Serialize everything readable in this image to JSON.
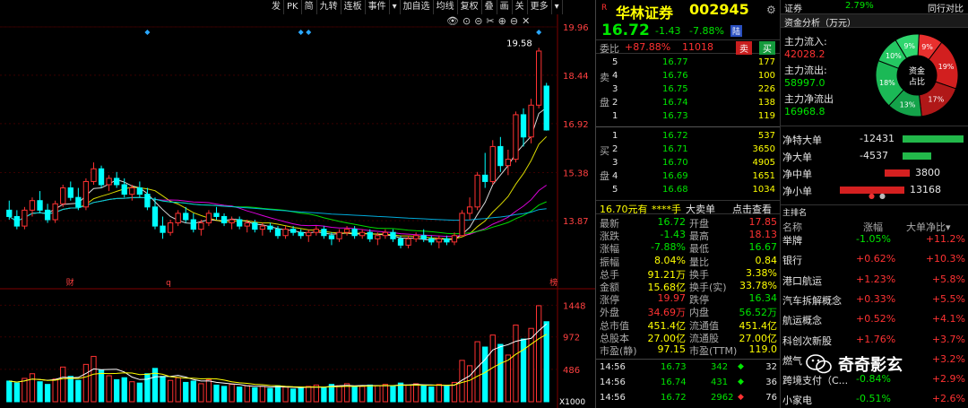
{
  "toolbar": {
    "items": [
      "发",
      "PK",
      "简",
      "九转",
      "连板",
      "事件",
      "▾",
      "加自选",
      "均线",
      "复权",
      "叠",
      "画",
      "关",
      "更多",
      "▾"
    ]
  },
  "iconbar": [
    "👁",
    "⊙",
    "⊝",
    "✂",
    "⊕",
    "⊖",
    "✕"
  ],
  "chart_data": {
    "type": "candlestick",
    "price_axis": {
      "ticks": [
        "19.96",
        "18.44",
        "16.92",
        "15.38",
        "13.87"
      ],
      "ylim": [
        12.35,
        19.96
      ]
    },
    "volume_axis": {
      "ticks": [
        "1448",
        "972",
        "486"
      ],
      "unit": "X1000"
    },
    "high_label": "19.58",
    "markers": [
      "财",
      "q",
      "榜"
    ],
    "candles": [
      {
        "o": 14.2,
        "h": 14.5,
        "l": 13.9,
        "c": 14.0
      },
      {
        "o": 14.0,
        "h": 14.2,
        "l": 13.6,
        "c": 13.7
      },
      {
        "o": 13.7,
        "h": 14.3,
        "l": 13.6,
        "c": 14.2
      },
      {
        "o": 14.2,
        "h": 14.6,
        "l": 14.0,
        "c": 14.5
      },
      {
        "o": 14.5,
        "h": 14.8,
        "l": 14.1,
        "c": 14.2
      },
      {
        "o": 14.2,
        "h": 14.4,
        "l": 13.8,
        "c": 13.9
      },
      {
        "o": 13.9,
        "h": 14.5,
        "l": 13.8,
        "c": 14.4
      },
      {
        "o": 14.4,
        "h": 15.0,
        "l": 14.3,
        "c": 14.9
      },
      {
        "o": 14.9,
        "h": 15.1,
        "l": 14.5,
        "c": 14.6
      },
      {
        "o": 14.6,
        "h": 14.9,
        "l": 14.2,
        "c": 14.3
      },
      {
        "o": 14.3,
        "h": 15.2,
        "l": 14.2,
        "c": 15.1
      },
      {
        "o": 15.1,
        "h": 15.7,
        "l": 15.0,
        "c": 15.5
      },
      {
        "o": 15.5,
        "h": 15.6,
        "l": 14.9,
        "c": 15.0
      },
      {
        "o": 15.0,
        "h": 15.3,
        "l": 14.8,
        "c": 15.2
      },
      {
        "o": 15.2,
        "h": 15.4,
        "l": 14.9,
        "c": 15.0
      },
      {
        "o": 15.0,
        "h": 15.2,
        "l": 14.6,
        "c": 14.7
      },
      {
        "o": 14.7,
        "h": 15.0,
        "l": 14.5,
        "c": 14.9
      },
      {
        "o": 14.9,
        "h": 15.1,
        "l": 14.6,
        "c": 14.7
      },
      {
        "o": 14.7,
        "h": 14.9,
        "l": 14.2,
        "c": 14.3
      },
      {
        "o": 14.3,
        "h": 14.6,
        "l": 13.6,
        "c": 13.7
      },
      {
        "o": 13.7,
        "h": 14.0,
        "l": 13.3,
        "c": 13.5
      },
      {
        "o": 13.5,
        "h": 13.9,
        "l": 13.4,
        "c": 13.8
      },
      {
        "o": 13.8,
        "h": 14.2,
        "l": 13.7,
        "c": 14.1
      },
      {
        "o": 14.1,
        "h": 14.3,
        "l": 13.8,
        "c": 13.9
      },
      {
        "o": 13.9,
        "h": 14.1,
        "l": 13.5,
        "c": 13.6
      },
      {
        "o": 13.6,
        "h": 13.9,
        "l": 13.4,
        "c": 13.8
      },
      {
        "o": 13.8,
        "h": 14.2,
        "l": 13.7,
        "c": 14.1
      },
      {
        "o": 14.1,
        "h": 14.3,
        "l": 13.9,
        "c": 14.0
      },
      {
        "o": 14.0,
        "h": 14.1,
        "l": 13.7,
        "c": 13.8
      },
      {
        "o": 13.8,
        "h": 14.0,
        "l": 13.6,
        "c": 13.9
      },
      {
        "o": 13.9,
        "h": 14.0,
        "l": 13.6,
        "c": 13.7
      },
      {
        "o": 13.7,
        "h": 13.9,
        "l": 13.5,
        "c": 13.8
      },
      {
        "o": 13.8,
        "h": 13.9,
        "l": 13.5,
        "c": 13.6
      },
      {
        "o": 13.6,
        "h": 13.8,
        "l": 13.4,
        "c": 13.7
      },
      {
        "o": 13.7,
        "h": 13.8,
        "l": 13.5,
        "c": 13.6
      },
      {
        "o": 13.6,
        "h": 13.7,
        "l": 13.3,
        "c": 13.4
      },
      {
        "o": 13.4,
        "h": 13.7,
        "l": 13.3,
        "c": 13.6
      },
      {
        "o": 13.6,
        "h": 13.7,
        "l": 13.4,
        "c": 13.5
      },
      {
        "o": 13.5,
        "h": 13.6,
        "l": 13.3,
        "c": 13.4
      },
      {
        "o": 13.4,
        "h": 13.6,
        "l": 13.2,
        "c": 13.5
      },
      {
        "o": 13.5,
        "h": 13.7,
        "l": 13.4,
        "c": 13.6
      },
      {
        "o": 13.6,
        "h": 13.7,
        "l": 13.3,
        "c": 13.4
      },
      {
        "o": 13.4,
        "h": 13.5,
        "l": 13.1,
        "c": 13.3
      },
      {
        "o": 13.3,
        "h": 13.6,
        "l": 13.2,
        "c": 13.5
      },
      {
        "o": 13.5,
        "h": 13.7,
        "l": 13.4,
        "c": 13.6
      },
      {
        "o": 13.6,
        "h": 13.7,
        "l": 13.3,
        "c": 13.4
      },
      {
        "o": 13.4,
        "h": 13.6,
        "l": 13.3,
        "c": 13.5
      },
      {
        "o": 13.5,
        "h": 13.6,
        "l": 13.2,
        "c": 13.3
      },
      {
        "o": 13.3,
        "h": 13.5,
        "l": 13.1,
        "c": 13.4
      },
      {
        "o": 13.4,
        "h": 13.6,
        "l": 13.3,
        "c": 13.5
      },
      {
        "o": 13.5,
        "h": 13.6,
        "l": 13.2,
        "c": 13.3
      },
      {
        "o": 13.3,
        "h": 13.4,
        "l": 13.0,
        "c": 13.1
      },
      {
        "o": 13.1,
        "h": 13.4,
        "l": 13.0,
        "c": 13.3
      },
      {
        "o": 13.3,
        "h": 13.5,
        "l": 13.2,
        "c": 13.4
      },
      {
        "o": 13.4,
        "h": 13.6,
        "l": 13.2,
        "c": 13.3
      },
      {
        "o": 13.3,
        "h": 13.4,
        "l": 13.1,
        "c": 13.2
      },
      {
        "o": 13.2,
        "h": 13.4,
        "l": 13.0,
        "c": 13.3
      },
      {
        "o": 13.3,
        "h": 13.4,
        "l": 13.1,
        "c": 13.2
      },
      {
        "o": 13.2,
        "h": 13.5,
        "l": 13.1,
        "c": 13.4
      },
      {
        "o": 13.4,
        "h": 14.2,
        "l": 13.4,
        "c": 14.1
      },
      {
        "o": 14.1,
        "h": 14.6,
        "l": 13.9,
        "c": 14.3
      },
      {
        "o": 14.3,
        "h": 15.4,
        "l": 14.2,
        "c": 15.3
      },
      {
        "o": 15.3,
        "h": 16.0,
        "l": 14.9,
        "c": 15.1
      },
      {
        "o": 15.1,
        "h": 16.4,
        "l": 15.0,
        "c": 16.2
      },
      {
        "o": 16.2,
        "h": 16.5,
        "l": 15.4,
        "c": 15.6
      },
      {
        "o": 15.6,
        "h": 16.1,
        "l": 15.3,
        "c": 15.8
      },
      {
        "o": 15.8,
        "h": 17.3,
        "l": 15.7,
        "c": 17.2
      },
      {
        "o": 17.2,
        "h": 17.4,
        "l": 16.2,
        "c": 16.5
      },
      {
        "o": 16.5,
        "h": 17.7,
        "l": 16.3,
        "c": 17.5
      },
      {
        "o": 17.5,
        "h": 19.3,
        "l": 17.4,
        "c": 19.2
      },
      {
        "o": 18.1,
        "h": 18.2,
        "l": 16.7,
        "c": 16.72
      }
    ],
    "volumes": [
      {
        "v": 310,
        "up": 0
      },
      {
        "v": 280,
        "up": 0
      },
      {
        "v": 350,
        "up": 1
      },
      {
        "v": 420,
        "up": 1
      },
      {
        "v": 300,
        "up": 0
      },
      {
        "v": 260,
        "up": 0
      },
      {
        "v": 340,
        "up": 1
      },
      {
        "v": 520,
        "up": 1
      },
      {
        "v": 380,
        "up": 0
      },
      {
        "v": 320,
        "up": 0
      },
      {
        "v": 560,
        "up": 1
      },
      {
        "v": 680,
        "up": 1
      },
      {
        "v": 470,
        "up": 0
      },
      {
        "v": 390,
        "up": 1
      },
      {
        "v": 330,
        "up": 0
      },
      {
        "v": 360,
        "up": 0
      },
      {
        "v": 300,
        "up": 1
      },
      {
        "v": 280,
        "up": 0
      },
      {
        "v": 420,
        "up": 0
      },
      {
        "v": 500,
        "up": 0
      },
      {
        "v": 380,
        "up": 0
      },
      {
        "v": 320,
        "up": 1
      },
      {
        "v": 360,
        "up": 1
      },
      {
        "v": 290,
        "up": 0
      },
      {
        "v": 310,
        "up": 0
      },
      {
        "v": 270,
        "up": 1
      },
      {
        "v": 330,
        "up": 1
      },
      {
        "v": 250,
        "up": 0
      },
      {
        "v": 230,
        "up": 0
      },
      {
        "v": 260,
        "up": 1
      },
      {
        "v": 220,
        "up": 0
      },
      {
        "v": 240,
        "up": 1
      },
      {
        "v": 210,
        "up": 0
      },
      {
        "v": 230,
        "up": 1
      },
      {
        "v": 200,
        "up": 0
      },
      {
        "v": 240,
        "up": 0
      },
      {
        "v": 220,
        "up": 1
      },
      {
        "v": 190,
        "up": 0
      },
      {
        "v": 210,
        "up": 0
      },
      {
        "v": 230,
        "up": 1
      },
      {
        "v": 250,
        "up": 1
      },
      {
        "v": 210,
        "up": 0
      },
      {
        "v": 260,
        "up": 0
      },
      {
        "v": 240,
        "up": 1
      },
      {
        "v": 270,
        "up": 1
      },
      {
        "v": 220,
        "up": 0
      },
      {
        "v": 230,
        "up": 1
      },
      {
        "v": 250,
        "up": 0
      },
      {
        "v": 240,
        "up": 1
      },
      {
        "v": 260,
        "up": 1
      },
      {
        "v": 230,
        "up": 0
      },
      {
        "v": 280,
        "up": 0
      },
      {
        "v": 250,
        "up": 1
      },
      {
        "v": 270,
        "up": 1
      },
      {
        "v": 240,
        "up": 0
      },
      {
        "v": 220,
        "up": 0
      },
      {
        "v": 260,
        "up": 1
      },
      {
        "v": 230,
        "up": 0
      },
      {
        "v": 290,
        "up": 1
      },
      {
        "v": 620,
        "up": 1
      },
      {
        "v": 540,
        "up": 1
      },
      {
        "v": 900,
        "up": 1
      },
      {
        "v": 820,
        "up": 0
      },
      {
        "v": 1000,
        "up": 1
      },
      {
        "v": 860,
        "up": 0
      },
      {
        "v": 700,
        "up": 1
      },
      {
        "v": 1150,
        "up": 1
      },
      {
        "v": 940,
        "up": 0
      },
      {
        "v": 1100,
        "up": 1
      },
      {
        "v": 1440,
        "up": 1
      },
      {
        "v": 1200,
        "up": 0
      }
    ]
  },
  "quote": {
    "flag": "R",
    "name": "华林证券",
    "code": "002945",
    "price": "16.72",
    "change": "-1.43",
    "change_pct": "-7.88%",
    "tag": "陆",
    "weibi_label": "委比",
    "weibi_value": "+87.88%",
    "weicha_value": "11018",
    "sell_btn": "卖",
    "buy_btn": "买",
    "sell_label_1": "卖",
    "sell_label_2": "盘",
    "buy_label_1": "买",
    "buy_label_2": "盘",
    "asks": [
      {
        "lvl": "5",
        "price": "16.77",
        "vol": "177"
      },
      {
        "lvl": "4",
        "price": "16.76",
        "vol": "100"
      },
      {
        "lvl": "3",
        "price": "16.75",
        "vol": "226"
      },
      {
        "lvl": "2",
        "price": "16.74",
        "vol": "138"
      },
      {
        "lvl": "1",
        "price": "16.73",
        "vol": "119"
      }
    ],
    "bids": [
      {
        "lvl": "1",
        "price": "16.72",
        "vol": "537"
      },
      {
        "lvl": "2",
        "price": "16.71",
        "vol": "3650"
      },
      {
        "lvl": "3",
        "price": "16.70",
        "vol": "4905"
      },
      {
        "lvl": "4",
        "price": "16.69",
        "vol": "1651"
      },
      {
        "lvl": "5",
        "price": "16.68",
        "vol": "1034"
      }
    ],
    "big_order_line": {
      "price": "16.70元有",
      "vol": "****手",
      "label": "大卖单",
      "link": "点击查看"
    },
    "stats": [
      {
        "l1": "最新",
        "v1": "16.72",
        "c1": "green",
        "l2": "开盘",
        "v2": "17.85",
        "c2": "red"
      },
      {
        "l1": "涨跌",
        "v1": "-1.43",
        "c1": "green",
        "l2": "最高",
        "v2": "18.13",
        "c2": "red"
      },
      {
        "l1": "涨幅",
        "v1": "-7.88%",
        "c1": "green",
        "l2": "最低",
        "v2": "16.67",
        "c2": "green"
      },
      {
        "l1": "振幅",
        "v1": "8.04%",
        "c1": "yellow",
        "l2": "量比",
        "v2": "0.84",
        "c2": "yellow"
      },
      {
        "l1": "总手",
        "v1": "91.21万",
        "c1": "yellow",
        "l2": "换手",
        "v2": "3.38%",
        "c2": "yellow"
      },
      {
        "l1": "金额",
        "v1": "15.68亿",
        "c1": "yellow",
        "l2": "换手(实)",
        "v2": "33.78%",
        "c2": "yellow"
      },
      {
        "l1": "涨停",
        "v1": "19.97",
        "c1": "red",
        "l2": "跌停",
        "v2": "16.34",
        "c2": "green"
      },
      {
        "l1": "外盘",
        "v1": "34.69万",
        "c1": "red",
        "l2": "内盘",
        "v2": "56.52万",
        "c2": "green"
      },
      {
        "l1": "总市值",
        "v1": "451.4亿",
        "c1": "yellow",
        "l2": "流通值",
        "v2": "451.4亿",
        "c2": "yellow"
      },
      {
        "l1": "总股本",
        "v1": "27.00亿",
        "c1": "yellow",
        "l2": "流通股",
        "v2": "27.00亿",
        "c2": "yellow"
      },
      {
        "l1": "市盈(静)",
        "v1": "97.15",
        "c1": "yellow",
        "l2": "市盈(TTM)",
        "v2": "119.0",
        "c2": "yellow"
      }
    ],
    "trades": [
      {
        "t": "14:56",
        "p": "16.73",
        "v": "342",
        "dir": "up",
        "n": "32"
      },
      {
        "t": "14:56",
        "p": "16.74",
        "v": "431",
        "dir": "up",
        "n": "36"
      },
      {
        "t": "14:56",
        "p": "16.72",
        "v": "2962",
        "dir": "down",
        "n": "76"
      }
    ]
  },
  "right": {
    "top_label": "证券",
    "top_value": "2.79%",
    "top_right": "同行对比",
    "fund_title": "资金分析（万元）",
    "inflow_label": "主力流入:",
    "inflow_value": "42028.2",
    "outflow_label": "主力流出:",
    "outflow_value": "58997.0",
    "net_label": "主力净流出",
    "net_value": "16968.8",
    "donut_center_1": "资金",
    "donut_center_2": "占比",
    "donut": [
      {
        "pct": 9,
        "color": "#e8302e",
        "label": "9%"
      },
      {
        "pct": 19,
        "color": "#d21f1f",
        "label": "19%"
      },
      {
        "pct": 17,
        "color": "#b01818",
        "label": "17%"
      },
      {
        "pct": 13,
        "color": "#14a34a",
        "label": "13%"
      },
      {
        "pct": 18,
        "color": "#1bb956",
        "label": "18%"
      },
      {
        "pct": 10,
        "color": "#24c862",
        "label": "10%"
      },
      {
        "pct": 9,
        "color": "#2fd66e",
        "label": "9%"
      }
    ],
    "flows": [
      {
        "label": "净特大单",
        "value": "-12431",
        "color": "#22b84a",
        "w": 68,
        "x": 136
      },
      {
        "label": "净大单",
        "value": "-4537",
        "color": "#22b84a",
        "w": 32,
        "x": 136
      },
      {
        "label": "净中单",
        "value": "3800",
        "color": "#d42020",
        "w": 28,
        "x": 116
      },
      {
        "label": "净小单",
        "value": "13168",
        "color": "#d42020",
        "w": 72,
        "x": 66
      }
    ],
    "sector_header": {
      "tab": "主排名",
      "c1": "名称",
      "c2": "涨幅",
      "c3": "大单净比▾"
    },
    "sectors": [
      {
        "name": "举牌",
        "chg": "-1.05%",
        "chgc": "green",
        "net": "+11.2%"
      },
      {
        "name": "银行",
        "chg": "+0.62%",
        "chgc": "red",
        "net": "+10.3%"
      },
      {
        "name": "港口航运",
        "chg": "+1.23%",
        "chgc": "red",
        "net": "+5.8%"
      },
      {
        "name": "汽车拆解概念",
        "chg": "+0.33%",
        "chgc": "red",
        "net": "+5.5%"
      },
      {
        "name": "航运概念",
        "chg": "+0.52%",
        "chgc": "red",
        "net": "+4.1%"
      },
      {
        "name": "科创次新股",
        "chg": "+1.76%",
        "chgc": "red",
        "net": "+3.7%"
      },
      {
        "name": "燃气",
        "chg": "",
        "chgc": "red",
        "net": "+3.2%"
      },
      {
        "name": "跨境支付（C...",
        "chg": "-0.84%",
        "chgc": "green",
        "net": "+2.9%"
      },
      {
        "name": "小家电",
        "chg": "-0.51%",
        "chgc": "green",
        "net": "+2.6%"
      }
    ],
    "watermark": "奇奇影玄"
  }
}
